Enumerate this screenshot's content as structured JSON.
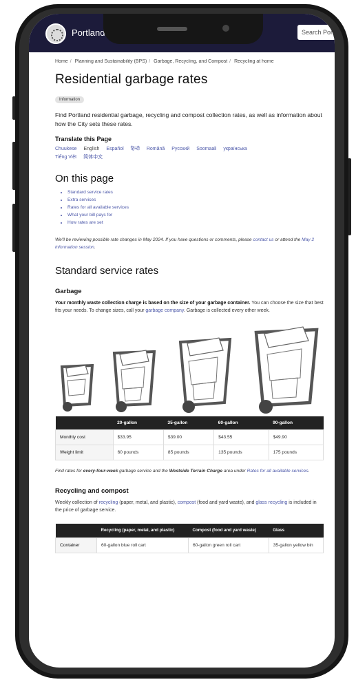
{
  "site": {
    "brand": "Portland",
    "search_placeholder": "Search Portland"
  },
  "breadcrumb": [
    "Home",
    "Planning and Sustainability (BPS)",
    "Garbage, Recycling, and Compost",
    "Recycling at home"
  ],
  "page": {
    "title": "Residential garbage rates",
    "badge": "Information",
    "intro": "Find Portland residential garbage, recycling and compost collection rates, as well as information about how the City sets these rates."
  },
  "translate": {
    "title": "Translate this Page",
    "languages": [
      "Chuukese",
      "English",
      "Español",
      "हिन्दी",
      "Română",
      "Русский",
      "Soomaali",
      "українська",
      "Tiếng Việt",
      "简体中文"
    ]
  },
  "toc": {
    "title": "On this page",
    "items": [
      "Standard service rates",
      "Extra services",
      "Rates for all available services",
      "What your bill pays for",
      "How rates are set"
    ]
  },
  "notice": {
    "text": "We'll be reviewing possible rate changes in May 2024. If you have questions or comments, please ",
    "link1": "contact us",
    "mid": " or attend the ",
    "link2": "May 2 information session",
    "end": "."
  },
  "standard": {
    "title": "Standard service rates",
    "garbage_title": "Garbage",
    "garbage_bold": "Your monthly waste collection charge is based on the size of your garbage container.",
    "garbage_text": " You can choose the size that best fits your needs. To change sizes, call your ",
    "garbage_link": "garbage company",
    "garbage_end": ". Garbage is collected every other week."
  },
  "garbage_table": {
    "headers": [
      "",
      "20-gallon",
      "35-gallon",
      "60-gallon",
      "90-gallon"
    ],
    "rows": [
      [
        "Monthly cost",
        "$33.95",
        "$39.00",
        "$43.55",
        "$49.90"
      ],
      [
        "Weight limit",
        "60 pounds",
        "85 pounds",
        "135 pounds",
        "175 pounds"
      ]
    ]
  },
  "footnote": {
    "pre": "Find rates for ",
    "bold1": "every-four-week",
    "mid": " garbage service and the ",
    "bold2": "Westside Terrain Charge",
    "mid2": " area under ",
    "link": "Rates for all available services",
    "end": "."
  },
  "recycling": {
    "title": "Recycling and compost",
    "pre": "Weekly collection of ",
    "link1": "recycling",
    "mid1": " (paper, metal, and plastic), ",
    "link2": "compost",
    "mid2": " (food and yard waste), and ",
    "link3": "glass recycling",
    "end": " is included in the price of garbage service."
  },
  "recycling_table": {
    "headers": [
      "",
      "Recycling (paper, metal, and plastic)",
      "Compost (food and yard waste)",
      "Glass"
    ],
    "rows": [
      [
        "Container",
        "60-gallon blue roll cart",
        "60-gallon green roll cart",
        "35-gallon yellow bin"
      ]
    ]
  },
  "colors": {
    "header_bg": "#1c1b3a",
    "link": "#4a56a8",
    "table_header": "#222222"
  }
}
